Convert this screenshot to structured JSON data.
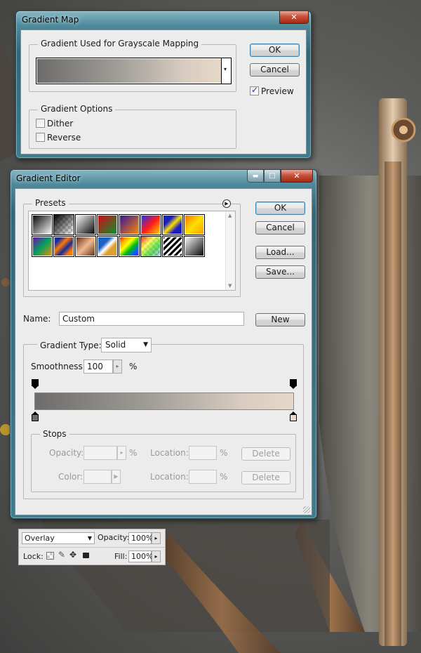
{
  "gradient_map": {
    "title": "Gradient Map",
    "used_group_label": "Gradient Used for Grayscale Mapping",
    "ok_label": "OK",
    "cancel_label": "Cancel",
    "preview_label": "Preview",
    "preview_checked": true,
    "options_group_label": "Gradient Options",
    "dither_label": "Dither",
    "reverse_label": "Reverse"
  },
  "gradient_editor": {
    "title": "Gradient Editor",
    "presets_label": "Presets",
    "ok_label": "OK",
    "cancel_label": "Cancel",
    "load_label": "Load...",
    "save_label": "Save...",
    "name_label": "Name:",
    "name_value": "Custom",
    "new_label": "New",
    "type_label": "Gradient Type:",
    "type_value": "Solid",
    "smoothness_label": "Smoothness:",
    "smoothness_value": "100",
    "percent": "%",
    "stops_group_label": "Stops",
    "opacity_label": "Opacity:",
    "color_label": "Color:",
    "location_label": "Location:",
    "delete_label": "Delete",
    "gradient_start_color": "#6d6c6a",
    "gradient_end_color": "#e6d8c8"
  },
  "layers": {
    "blend_mode": "Overlay",
    "opacity_label": "Opacity:",
    "opacity_value": "100%",
    "lock_label": "Lock:",
    "fill_label": "Fill:",
    "fill_value": "100%"
  }
}
